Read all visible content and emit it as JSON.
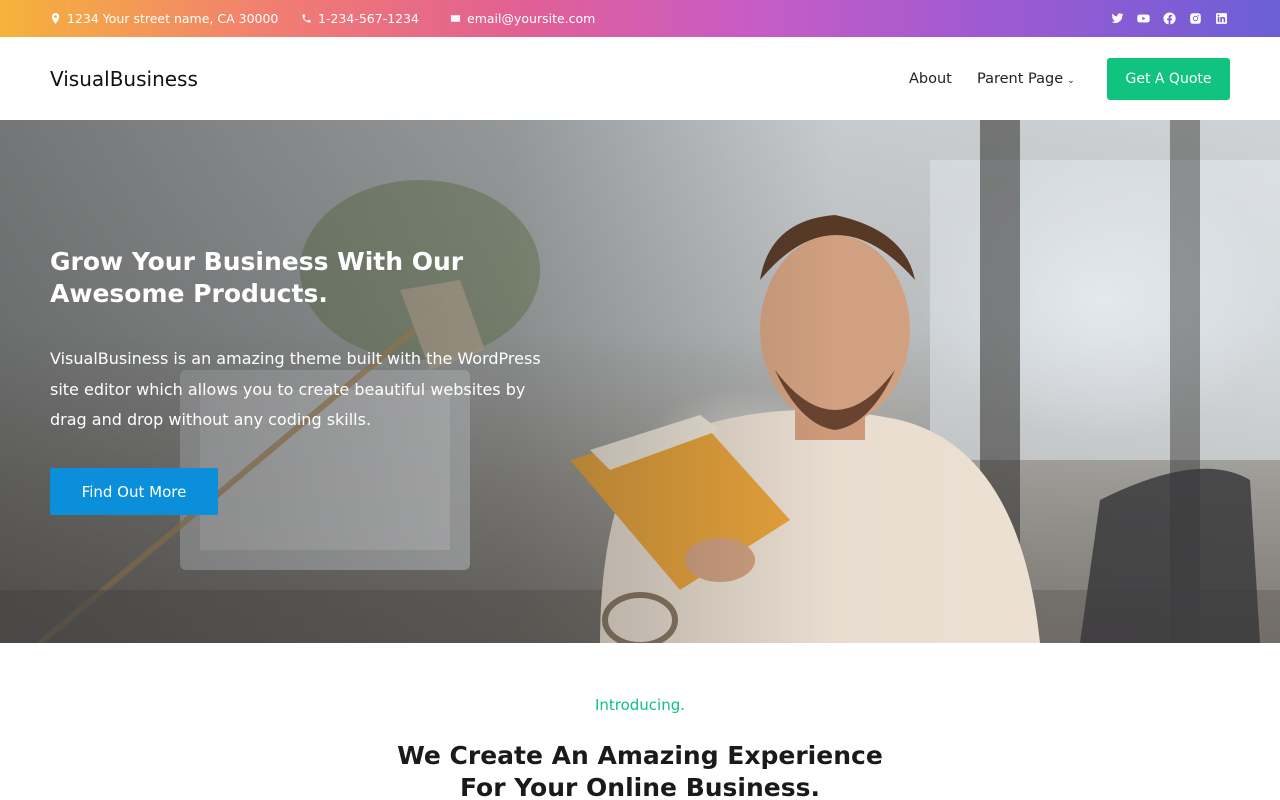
{
  "topbar": {
    "address": "1234 Your street name, CA 30000",
    "phone": "1-234-567-1234",
    "email": "email@yoursite.com",
    "social": [
      "twitter-icon",
      "youtube-icon",
      "facebook-icon",
      "instagram-icon",
      "linkedin-icon"
    ]
  },
  "header": {
    "logo": "VisualBusiness",
    "nav": {
      "about": "About",
      "parent_page": "Parent Page"
    },
    "quote_button": "Get A Quote"
  },
  "hero": {
    "title": "Grow Your Business With Our Awesome Products.",
    "text": "VisualBusiness is an amazing theme built with the WordPress site editor which allows you to create beautiful websites by drag and drop without any coding skills.",
    "button": "Find Out More"
  },
  "intro": {
    "label": "Introducing.",
    "heading": "We Create An Amazing Experience For Your Online Business."
  },
  "colors": {
    "accent_green": "#10c37f",
    "button_blue": "#0b8fdb"
  }
}
